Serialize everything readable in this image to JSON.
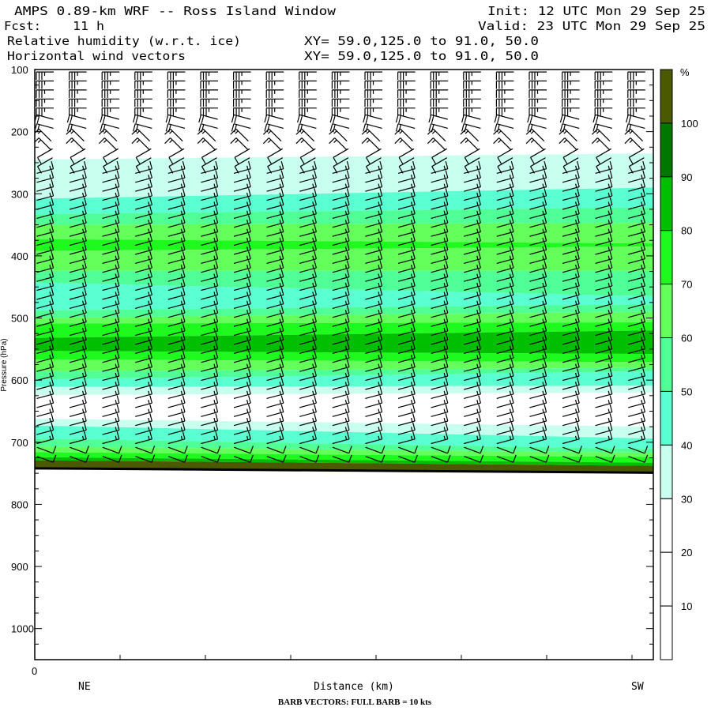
{
  "header": {
    "title": "AMPS 0.89-km WRF -- Ross Island Window",
    "init": "Init: 12 UTC Mon 29 Sep 25",
    "fcst_label": "Fcst:",
    "fcst_value": "11 h",
    "valid": "Valid: 23 UTC Mon 29 Sep 25",
    "field1": "Relative humidity (w.r.t. ice)",
    "field1_xy": "XY=  59.0,125.0 to  91.0, 50.0",
    "field2": "Horizontal wind vectors",
    "field2_xy": "XY=  59.0,125.0 to  91.0, 50.0"
  },
  "chart_data": {
    "type": "heatmap",
    "title": "Relative humidity (w.r.t. ice) cross-section with horizontal wind barbs",
    "xlabel": "Distance (km)",
    "x_origin_label": "0",
    "x_left_label": "NE",
    "x_right_label": "SW",
    "ylabel": "Pressure (hPa)",
    "ylim": [
      100,
      1050
    ],
    "yticks": [
      "100",
      "200",
      "300",
      "400",
      "500",
      "600",
      "700",
      "800",
      "900",
      "1000"
    ],
    "colorbar": {
      "unit": "%",
      "labels": [
        "100",
        "90",
        "80",
        "70",
        "60",
        "50",
        "40",
        "30",
        "20",
        "10"
      ],
      "classes": [
        {
          "range": ">100",
          "color": "#4b5a00"
        },
        {
          "range": "90-100",
          "color": "#007800"
        },
        {
          "range": "80-90",
          "color": "#00be00"
        },
        {
          "range": "70-80",
          "color": "#1efa1e"
        },
        {
          "range": "60-70",
          "color": "#64ff5a"
        },
        {
          "range": "50-60",
          "color": "#50ff96"
        },
        {
          "range": "40-50",
          "color": "#5affd2"
        },
        {
          "range": "30-40",
          "color": "#c8ffee"
        },
        {
          "range": "20-30",
          "color": "#ffffff"
        },
        {
          "range": "10-20",
          "color": "#ffffff"
        },
        {
          "range": "0-10",
          "color": "#ffffff"
        }
      ]
    },
    "rh_layers_hPa": [
      {
        "range": "20-30",
        "ne": [
          100,
          245
        ],
        "sw": [
          100,
          235
        ]
      },
      {
        "range": "30-40",
        "ne": [
          245,
          308
        ],
        "sw": [
          235,
          290
        ]
      },
      {
        "range": "40-50",
        "ne": [
          308,
          333
        ],
        "sw": [
          290,
          322
        ]
      },
      {
        "range": "50-60",
        "ne": [
          333,
          350
        ],
        "sw": [
          322,
          347
        ]
      },
      {
        "range": "60-70",
        "ne": [
          350,
          373
        ],
        "sw": [
          347,
          380
        ]
      },
      {
        "range": "70-80",
        "ne": [
          373,
          392
        ],
        "sw": [
          380,
          385
        ]
      },
      {
        "range": "60-70",
        "ne": [
          392,
          424
        ],
        "sw": [
          385,
          424
        ]
      },
      {
        "range": "50-60",
        "ne": [
          424,
          443
        ],
        "sw": [
          424,
          465
        ]
      },
      {
        "range": "40-50",
        "ne": [
          443,
          488
        ],
        "sw": [
          465,
          478
        ]
      },
      {
        "range": "50-60",
        "ne": [
          488,
          500
        ],
        "sw": [
          478,
          490
        ]
      },
      {
        "range": "60-70",
        "ne": [
          500,
          509
        ],
        "sw": [
          490,
          507
        ]
      },
      {
        "range": "70-80",
        "ne": [
          509,
          532
        ],
        "sw": [
          507,
          520
        ]
      },
      {
        "range": "80-90",
        "ne": [
          532,
          553
        ],
        "sw": [
          520,
          558
        ]
      },
      {
        "range": "70-80",
        "ne": [
          553,
          567
        ],
        "sw": [
          558,
          571
        ]
      },
      {
        "range": "60-70",
        "ne": [
          567,
          586
        ],
        "sw": [
          571,
          580
        ]
      },
      {
        "range": "50-60",
        "ne": [
          586,
          599
        ],
        "sw": [
          580,
          586
        ]
      },
      {
        "range": "40-50",
        "ne": [
          599,
          611
        ],
        "sw": [
          586,
          609
        ]
      },
      {
        "range": "30-40",
        "ne": [
          611,
          624
        ],
        "sw": [
          609,
          620
        ]
      },
      {
        "range": "20-30",
        "ne": [
          624,
          662
        ],
        "sw": [
          620,
          675
        ]
      },
      {
        "range": "30-40",
        "ne": [
          662,
          673
        ],
        "sw": [
          675,
          694
        ]
      },
      {
        "range": "40-50",
        "ne": [
          673,
          694
        ],
        "sw": [
          694,
          711
        ]
      },
      {
        "range": "50-60",
        "ne": [
          694,
          707
        ],
        "sw": [
          711,
          717
        ]
      },
      {
        "range": "60-70",
        "ne": [
          707,
          716
        ],
        "sw": [
          717,
          724
        ]
      },
      {
        "range": "70-80",
        "ne": [
          716,
          724
        ],
        "sw": [
          724,
          733
        ]
      },
      {
        "range": "80-90",
        "ne": [
          724,
          729
        ],
        "sw": [
          733,
          738
        ]
      },
      {
        "range": ">100",
        "ne": [
          729,
          742
        ],
        "sw": [
          738,
          749
        ]
      }
    ],
    "surface_pressure_hPa": {
      "ne": 742,
      "sw": 749
    },
    "wind": {
      "columns": 19,
      "profile": [
        {
          "p": [
            100,
            165
          ],
          "speed_kt": 35,
          "dir_deg": 270
        },
        {
          "p": [
            165,
            195
          ],
          "speed_kt": 20,
          "dir_deg": 285
        },
        {
          "p": [
            195,
            225
          ],
          "speed_kt": 15,
          "dir_deg": 315
        },
        {
          "p": [
            225,
            260
          ],
          "speed_kt": 10,
          "dir_deg": 240
        },
        {
          "p": [
            260,
            700
          ],
          "speed_kt": 15,
          "dir_deg": 75
        },
        {
          "p": [
            700,
            742
          ],
          "speed_kt": 10,
          "dir_deg": 110
        }
      ]
    }
  },
  "footer": {
    "barb_note": "BARB VECTORS:  FULL BARB = 10 kts"
  }
}
